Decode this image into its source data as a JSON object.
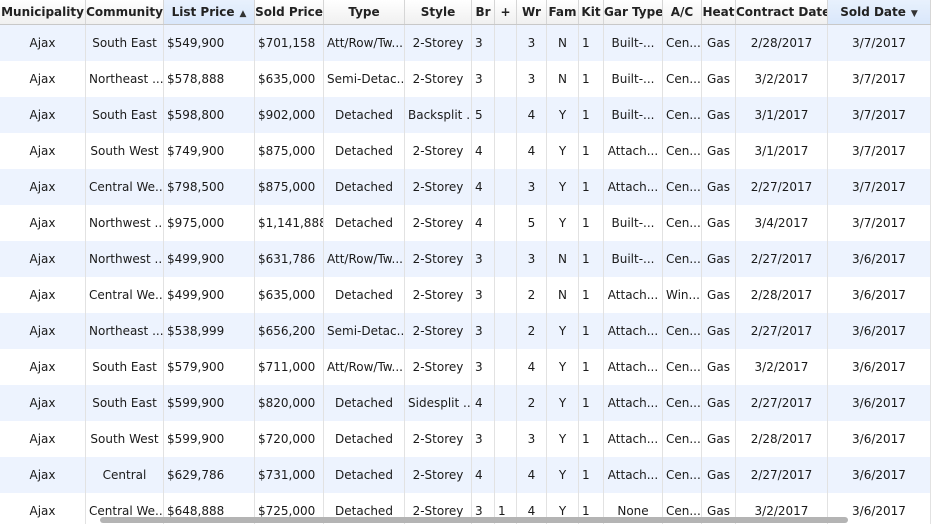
{
  "columns": [
    {
      "key": "municipality",
      "label": "Municipality",
      "w": 86,
      "align": "center"
    },
    {
      "key": "community",
      "label": "Community",
      "w": 78,
      "align": "center"
    },
    {
      "key": "list_price",
      "label": "List Price",
      "w": 91,
      "align": "left",
      "sorted": "asc"
    },
    {
      "key": "sold_price",
      "label": "Sold Price",
      "w": 69,
      "align": "left"
    },
    {
      "key": "type",
      "label": "Type",
      "w": 81,
      "align": "center"
    },
    {
      "key": "style",
      "label": "Style",
      "w": 67,
      "align": "center"
    },
    {
      "key": "br",
      "label": "Br",
      "w": 23,
      "align": "left"
    },
    {
      "key": "plus",
      "label": "+",
      "w": 22,
      "align": "left"
    },
    {
      "key": "wr",
      "label": "Wr",
      "w": 30,
      "align": "center"
    },
    {
      "key": "fam",
      "label": "Fam",
      "w": 32,
      "align": "center"
    },
    {
      "key": "kit",
      "label": "Kit",
      "w": 25,
      "align": "left"
    },
    {
      "key": "gar_type",
      "label": "Gar Type",
      "w": 59,
      "align": "center"
    },
    {
      "key": "ac",
      "label": "A/C",
      "w": 39,
      "align": "center"
    },
    {
      "key": "heat",
      "label": "Heat",
      "w": 34,
      "align": "center"
    },
    {
      "key": "contract_date",
      "label": "Contract Date",
      "w": 92,
      "align": "center"
    },
    {
      "key": "sold_date",
      "label": "Sold Date",
      "w": 103,
      "align": "center",
      "sorted": "desc"
    }
  ],
  "sort_asc_glyph": "▲",
  "sort_desc_glyph": "▼",
  "rows": [
    {
      "municipality": "Ajax",
      "community": "South East",
      "list_price": "$549,900",
      "sold_price": "$701,158",
      "type": "Att/Row/Tw...",
      "style": "2-Storey",
      "br": "3",
      "plus": "",
      "wr": "3",
      "fam": "N",
      "kit": "1",
      "gar_type": "Built-...",
      "ac": "Cen...",
      "heat": "Gas",
      "contract_date": "2/28/2017",
      "sold_date": "3/7/2017"
    },
    {
      "municipality": "Ajax",
      "community": "Northeast ...",
      "list_price": "$578,888",
      "sold_price": "$635,000",
      "type": "Semi-Detac...",
      "style": "2-Storey",
      "br": "3",
      "plus": "",
      "wr": "3",
      "fam": "N",
      "kit": "1",
      "gar_type": "Built-...",
      "ac": "Cen...",
      "heat": "Gas",
      "contract_date": "3/2/2017",
      "sold_date": "3/7/2017"
    },
    {
      "municipality": "Ajax",
      "community": "South East",
      "list_price": "$598,800",
      "sold_price": "$902,000",
      "type": "Detached",
      "style": "Backsplit ...",
      "br": "5",
      "plus": "",
      "wr": "4",
      "fam": "Y",
      "kit": "1",
      "gar_type": "Built-...",
      "ac": "Cen...",
      "heat": "Gas",
      "contract_date": "3/1/2017",
      "sold_date": "3/7/2017"
    },
    {
      "municipality": "Ajax",
      "community": "South West",
      "list_price": "$749,900",
      "sold_price": "$875,000",
      "type": "Detached",
      "style": "2-Storey",
      "br": "4",
      "plus": "",
      "wr": "4",
      "fam": "Y",
      "kit": "1",
      "gar_type": "Attach...",
      "ac": "Cen...",
      "heat": "Gas",
      "contract_date": "3/1/2017",
      "sold_date": "3/7/2017"
    },
    {
      "municipality": "Ajax",
      "community": "Central We...",
      "list_price": "$798,500",
      "sold_price": "$875,000",
      "type": "Detached",
      "style": "2-Storey",
      "br": "4",
      "plus": "",
      "wr": "3",
      "fam": "Y",
      "kit": "1",
      "gar_type": "Attach...",
      "ac": "Cen...",
      "heat": "Gas",
      "contract_date": "2/27/2017",
      "sold_date": "3/7/2017"
    },
    {
      "municipality": "Ajax",
      "community": "Northwest ...",
      "list_price": "$975,000",
      "sold_price": "$1,141,888",
      "type": "Detached",
      "style": "2-Storey",
      "br": "4",
      "plus": "",
      "wr": "5",
      "fam": "Y",
      "kit": "1",
      "gar_type": "Built-...",
      "ac": "Cen...",
      "heat": "Gas",
      "contract_date": "3/4/2017",
      "sold_date": "3/7/2017"
    },
    {
      "municipality": "Ajax",
      "community": "Northwest ...",
      "list_price": "$499,900",
      "sold_price": "$631,786",
      "type": "Att/Row/Tw...",
      "style": "2-Storey",
      "br": "3",
      "plus": "",
      "wr": "3",
      "fam": "N",
      "kit": "1",
      "gar_type": "Built-...",
      "ac": "Cen...",
      "heat": "Gas",
      "contract_date": "2/27/2017",
      "sold_date": "3/6/2017"
    },
    {
      "municipality": "Ajax",
      "community": "Central We...",
      "list_price": "$499,900",
      "sold_price": "$635,000",
      "type": "Detached",
      "style": "2-Storey",
      "br": "3",
      "plus": "",
      "wr": "2",
      "fam": "N",
      "kit": "1",
      "gar_type": "Attach...",
      "ac": "Win...",
      "heat": "Gas",
      "contract_date": "2/28/2017",
      "sold_date": "3/6/2017"
    },
    {
      "municipality": "Ajax",
      "community": "Northeast ...",
      "list_price": "$538,999",
      "sold_price": "$656,200",
      "type": "Semi-Detac...",
      "style": "2-Storey",
      "br": "3",
      "plus": "",
      "wr": "2",
      "fam": "Y",
      "kit": "1",
      "gar_type": "Attach...",
      "ac": "Cen...",
      "heat": "Gas",
      "contract_date": "2/27/2017",
      "sold_date": "3/6/2017"
    },
    {
      "municipality": "Ajax",
      "community": "South East",
      "list_price": "$579,900",
      "sold_price": "$711,000",
      "type": "Att/Row/Tw...",
      "style": "2-Storey",
      "br": "3",
      "plus": "",
      "wr": "4",
      "fam": "Y",
      "kit": "1",
      "gar_type": "Attach...",
      "ac": "Cen...",
      "heat": "Gas",
      "contract_date": "3/2/2017",
      "sold_date": "3/6/2017"
    },
    {
      "municipality": "Ajax",
      "community": "South East",
      "list_price": "$599,900",
      "sold_price": "$820,000",
      "type": "Detached",
      "style": "Sidesplit ...",
      "br": "4",
      "plus": "",
      "wr": "2",
      "fam": "Y",
      "kit": "1",
      "gar_type": "Attach...",
      "ac": "Cen...",
      "heat": "Gas",
      "contract_date": "2/27/2017",
      "sold_date": "3/6/2017"
    },
    {
      "municipality": "Ajax",
      "community": "South West",
      "list_price": "$599,900",
      "sold_price": "$720,000",
      "type": "Detached",
      "style": "2-Storey",
      "br": "3",
      "plus": "",
      "wr": "3",
      "fam": "Y",
      "kit": "1",
      "gar_type": "Attach...",
      "ac": "Cen...",
      "heat": "Gas",
      "contract_date": "2/28/2017",
      "sold_date": "3/6/2017"
    },
    {
      "municipality": "Ajax",
      "community": "Central",
      "list_price": "$629,786",
      "sold_price": "$731,000",
      "type": "Detached",
      "style": "2-Storey",
      "br": "4",
      "plus": "",
      "wr": "4",
      "fam": "Y",
      "kit": "1",
      "gar_type": "Attach...",
      "ac": "Cen...",
      "heat": "Gas",
      "contract_date": "2/27/2017",
      "sold_date": "3/6/2017"
    },
    {
      "municipality": "Ajax",
      "community": "Central We...",
      "list_price": "$648,888",
      "sold_price": "$725,000",
      "type": "Detached",
      "style": "2-Storey",
      "br": "3",
      "plus": "1",
      "wr": "4",
      "fam": "Y",
      "kit": "1",
      "gar_type": "None",
      "ac": "Cen...",
      "heat": "Gas",
      "contract_date": "3/2/2017",
      "sold_date": "3/6/2017"
    }
  ]
}
